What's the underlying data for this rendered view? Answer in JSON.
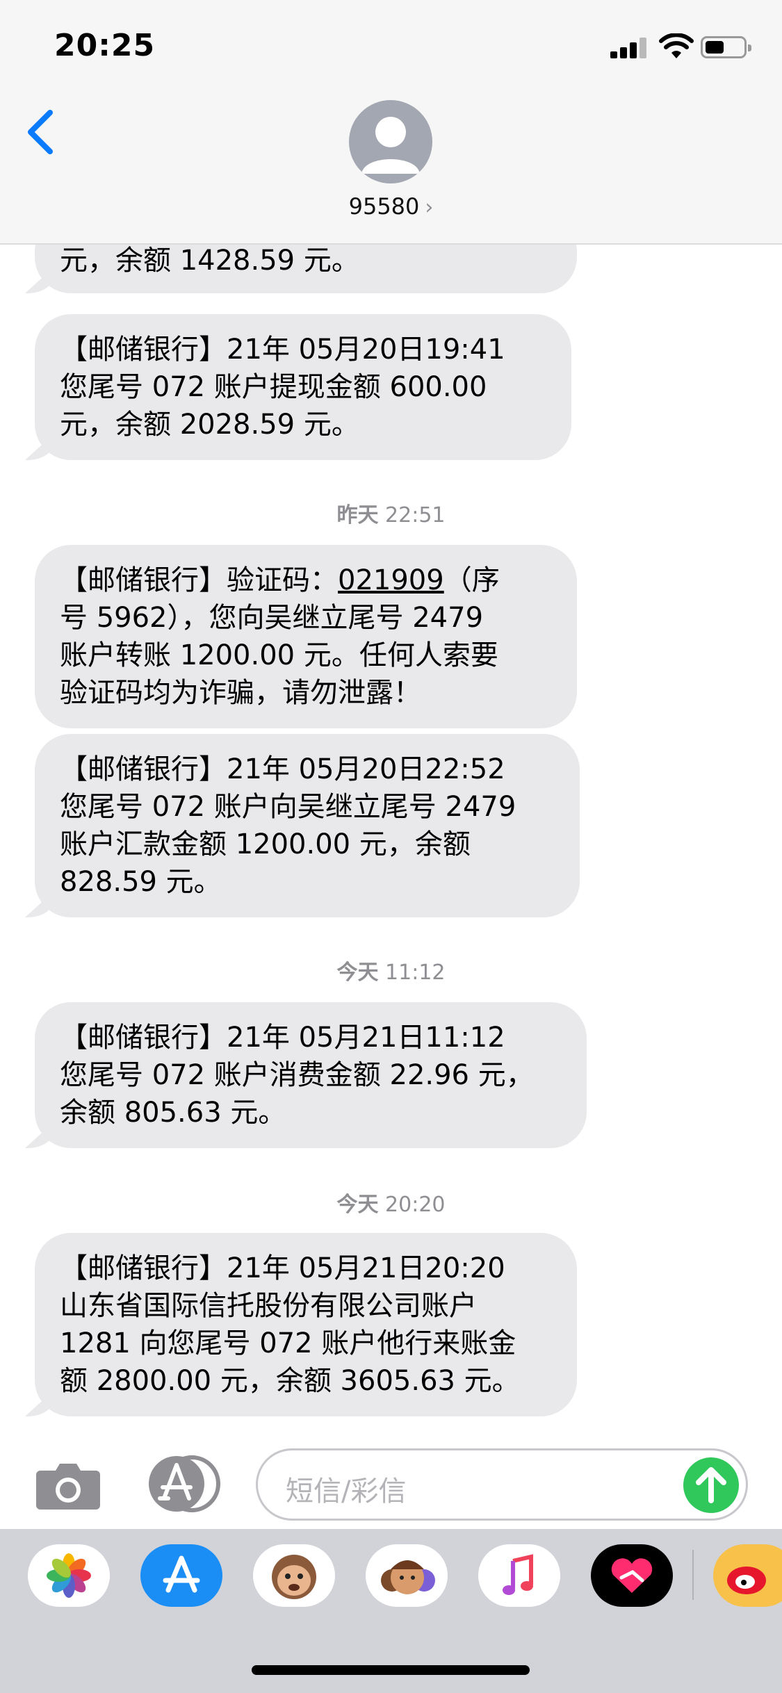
{
  "status": {
    "time": "20:25"
  },
  "header": {
    "contact": "95580",
    "chevron": "›"
  },
  "messages": [
    {
      "lines": [
        "元，余额 1428.59 元。"
      ]
    },
    {
      "lines": [
        "【邮储银行】21年 05月20日19:41",
        "您尾号 072 账户提现金额 600.00",
        "元，余额 2028.59 元。"
      ]
    },
    {
      "timestamp_day": "昨天",
      "timestamp_time": "22:51"
    },
    {
      "prefix": "【邮储银行】验证码：",
      "code": "021909",
      "suffix": "（序",
      "lines": [
        "号 5962），您向吴继立尾号 2479",
        "账户转账 1200.00 元。任何人索要",
        "验证码均为诈骗，请勿泄露！"
      ]
    },
    {
      "lines": [
        "【邮储银行】21年 05月20日22:52",
        "您尾号 072 账户向吴继立尾号 2479",
        "账户汇款金额 1200.00 元，余额",
        "828.59 元。"
      ]
    },
    {
      "timestamp_day": "今天",
      "timestamp_time": "11:12"
    },
    {
      "lines": [
        "【邮储银行】21年 05月21日11:12",
        "您尾号 072 账户消费金额 22.96 元，",
        "余额 805.63 元。"
      ]
    },
    {
      "timestamp_day": "今天",
      "timestamp_time": "20:20"
    },
    {
      "lines": [
        "【邮储银行】21年 05月21日20:20",
        "山东省国际信托股份有限公司账户",
        "1281 向您尾号 072 账户他行来账金",
        "额 2800.00 元，余额 3605.63 元。"
      ]
    }
  ],
  "input": {
    "placeholder": "短信/彩信"
  },
  "drawer": {
    "apps": [
      "photos-icon",
      "app-store-icon",
      "animoji-icon",
      "memoji-icon",
      "music-icon",
      "digital-touch-icon",
      "weibo-icon"
    ]
  },
  "colors": {
    "bubble": "#e9e9eb",
    "send": "#30c85a",
    "link": "#0a7aff"
  }
}
